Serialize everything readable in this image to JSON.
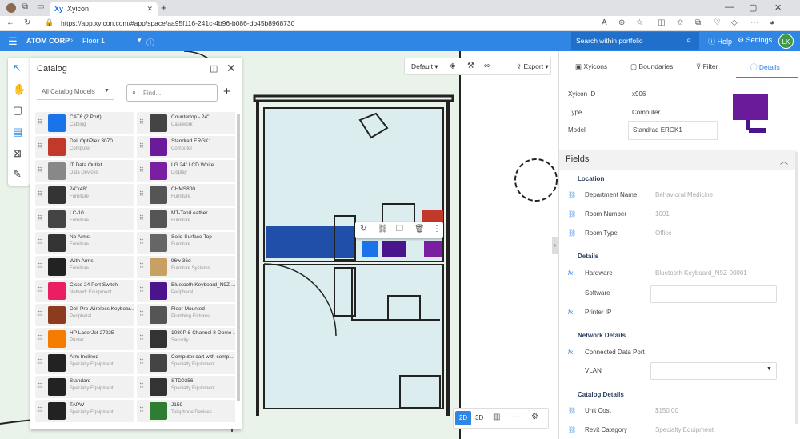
{
  "browser": {
    "tab_title": "Xyicon",
    "tab_icon": "Xy",
    "url": "https://app.xyicon.com/#app/space/aa95f116-241c-4b96-b086-db45b8968730"
  },
  "header": {
    "org": "ATOM CORP",
    "floor": "Floor 1",
    "search_placeholder": "Search within portfolio",
    "help": "Help",
    "settings": "Settings",
    "avatar": "LK"
  },
  "catalog": {
    "title": "Catalog",
    "filter": "All Catalog Models",
    "find_placeholder": "Find...",
    "items": [
      {
        "name": "CAT6 (2 Port)",
        "cat": "Cabling",
        "color": "#1a73e8"
      },
      {
        "name": "Countertop - 24\"",
        "cat": "Casework",
        "color": "#444"
      },
      {
        "name": "Dell OptiPlex 3070",
        "cat": "Computer",
        "color": "#c0392b"
      },
      {
        "name": "Standrad ERGK1",
        "cat": "Computer",
        "color": "#6a1b9a"
      },
      {
        "name": "IT Data Outlet",
        "cat": "Data Devices",
        "color": "#888"
      },
      {
        "name": "LG 24\" LCD White",
        "cat": "Display",
        "color": "#7b1fa2"
      },
      {
        "name": "24\"x48\"",
        "cat": "Furniture",
        "color": "#333"
      },
      {
        "name": "CHMS800",
        "cat": "Furniture",
        "color": "#555"
      },
      {
        "name": "LC-10",
        "cat": "Furniture",
        "color": "#444"
      },
      {
        "name": "MT-Tan/Leather",
        "cat": "Furniture",
        "color": "#555"
      },
      {
        "name": "No Arms",
        "cat": "Furniture",
        "color": "#333"
      },
      {
        "name": "Solid Surface Top",
        "cat": "Furniture",
        "color": "#666"
      },
      {
        "name": "With Arms",
        "cat": "Furniture",
        "color": "#222"
      },
      {
        "name": "96w 36d",
        "cat": "Furniture Systems",
        "color": "#c8a064"
      },
      {
        "name": "Cisco 24 Port Switch",
        "cat": "Network Equipment",
        "color": "#e91e63"
      },
      {
        "name": "Bluetooth Keyboard_N9Z-...",
        "cat": "Peripheral",
        "color": "#4a148c"
      },
      {
        "name": "Dell Pro Wireless Keyboar...",
        "cat": "Peripheral",
        "color": "#8d3b1f"
      },
      {
        "name": "Floor Mounted",
        "cat": "Plumbing Fixtures",
        "color": "#555"
      },
      {
        "name": "HP LaserJet 2722E",
        "cat": "Printer",
        "color": "#f57c00"
      },
      {
        "name": "1080P 8-Channel 8-Dome ...",
        "cat": "Security",
        "color": "#333"
      },
      {
        "name": "Arm Inclined",
        "cat": "Specialty Equipment",
        "color": "#222"
      },
      {
        "name": "Computer cart with comp...",
        "cat": "Specialty Equipment",
        "color": "#444"
      },
      {
        "name": "Standard",
        "cat": "Specialty Equipment",
        "color": "#222"
      },
      {
        "name": "STD0256",
        "cat": "Specialty Equipment",
        "color": "#333"
      },
      {
        "name": "TAPW",
        "cat": "Specialty Equipment",
        "color": "#222"
      },
      {
        "name": "J159",
        "cat": "Telephone Devices",
        "color": "#2e7d32"
      }
    ]
  },
  "plan_toolbar": {
    "view": "Default",
    "export": "Export"
  },
  "view_tools": {
    "d2": "2D",
    "d3": "3D"
  },
  "tabs": {
    "xyicons": "Xyicons",
    "boundaries": "Boundaries",
    "filter": "Filter",
    "details": "Details"
  },
  "details": {
    "id_label": "Xyicon ID",
    "id": "x906",
    "type_label": "Type",
    "type": "Computer",
    "model_label": "Model",
    "model": "Standrad ERGK1"
  },
  "fields": {
    "title": "Fields",
    "location": {
      "title": "Location",
      "dept_label": "Department Name",
      "dept": "Behavioral Medicine",
      "room_label": "Room Number",
      "room": "1001",
      "roomtype_label": "Room Type",
      "roomtype": "Office"
    },
    "det": {
      "title": "Details",
      "hw_label": "Hardware",
      "hw": "Bluetooth Keyboard_N9Z-00001",
      "sw_label": "Software",
      "ip_label": "Printer IP"
    },
    "net": {
      "title": "Network Details",
      "port_label": "Connected Data Port",
      "vlan_label": "VLAN"
    },
    "catdet": {
      "title": "Catalog Details",
      "cost_label": "Unit Cost",
      "cost": "$150.00",
      "revit_label": "Revit Category",
      "revit": "Specialty Equipment"
    }
  },
  "colors": {
    "accent": "#2f86e4",
    "room_fill": "#dcedf0",
    "workstation": "#1f4fa8"
  }
}
